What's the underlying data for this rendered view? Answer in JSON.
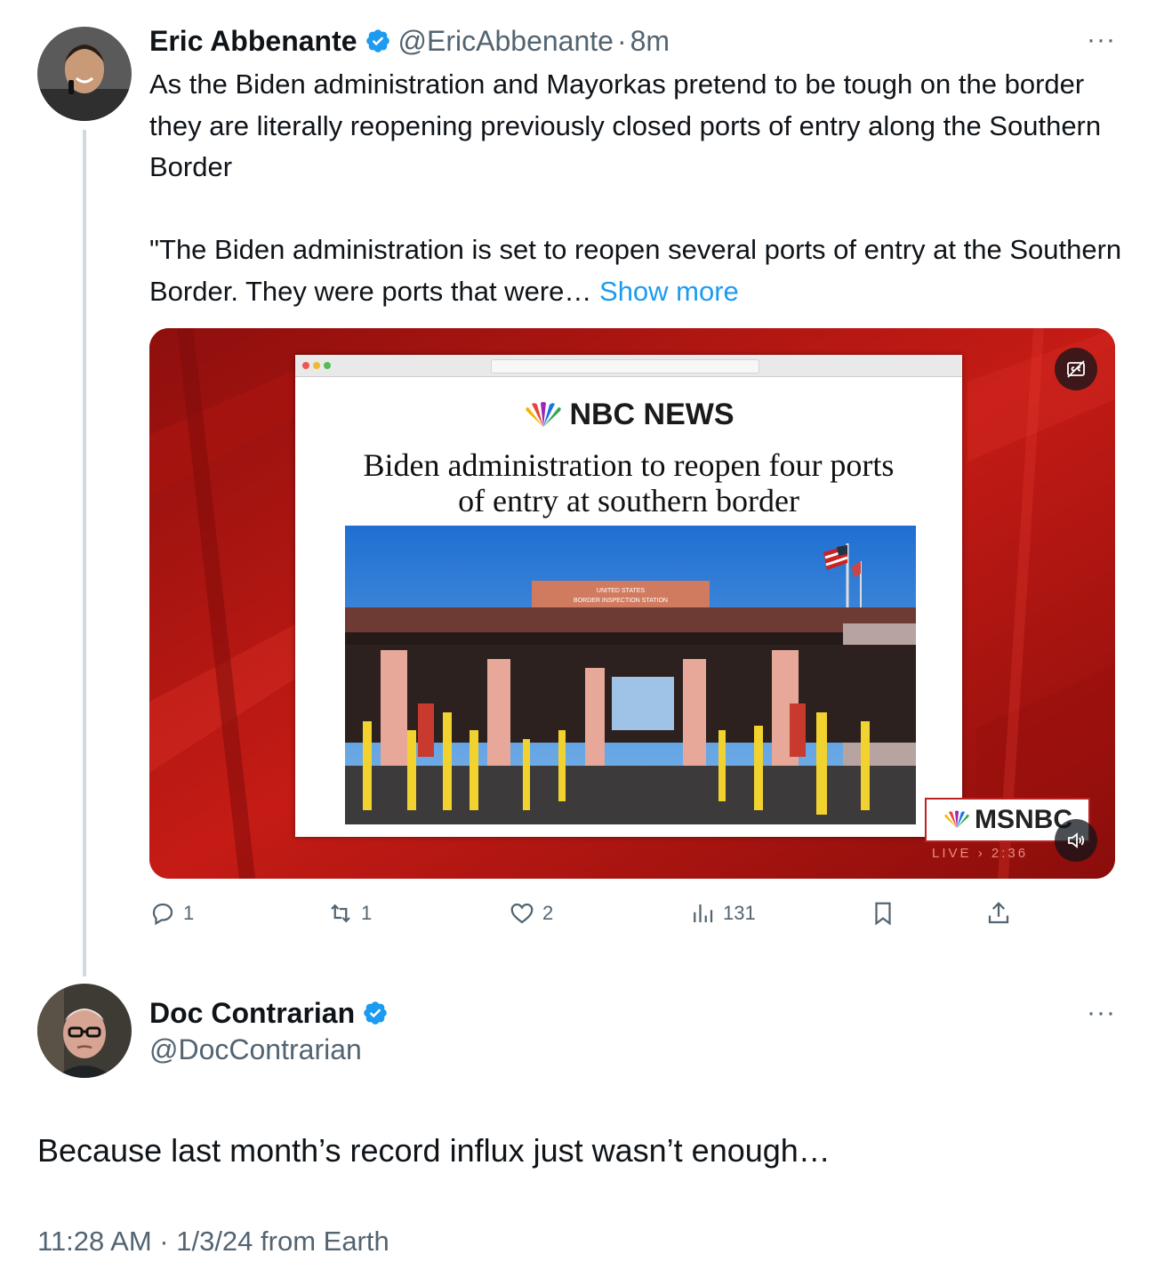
{
  "tweet": {
    "author_name": "Eric Abbenante",
    "handle": "@EricAbbenante",
    "separator": "·",
    "time": "8m",
    "more_label": "···",
    "paragraph1": "As the Biden administration and Mayorkas pretend to be tough on the border they are literally reopening previously closed ports of entry along the Southern Border",
    "paragraph2": "\"The Biden administration is set to reopen several ports of entry at the Southern Border. They were ports that were…",
    "show_more": "Show more",
    "media": {
      "outlet": "NBC NEWS",
      "headline_line1": "Biden administration to reopen four ports",
      "headline_line2": "of entry at southern border",
      "sign_line1": "UNITED STATES",
      "sign_line2": "BORDER INSPECTION STATION",
      "network": "MSNBC",
      "live_label": "LIVE",
      "live_time": "2:36"
    },
    "stats": {
      "replies": "1",
      "reposts": "1",
      "likes": "2",
      "views": "131"
    }
  },
  "reply": {
    "author_name": "Doc Contrarian",
    "handle": "@DocContrarian",
    "more_label": "···",
    "text": "Because last month’s record influx just wasn’t enough…",
    "timestamp": "11:28 AM · 1/3/24 from Earth"
  },
  "colors": {
    "accent": "#1d9bf0",
    "secondary_text": "#536471",
    "thread_line": "#cfd9de",
    "media_red": "#b01512"
  },
  "icons": [
    "verified-badge-icon",
    "more-icon",
    "caption-icon",
    "volume-icon",
    "reply-icon",
    "repost-icon",
    "like-icon",
    "views-icon",
    "bookmark-icon",
    "share-icon"
  ]
}
